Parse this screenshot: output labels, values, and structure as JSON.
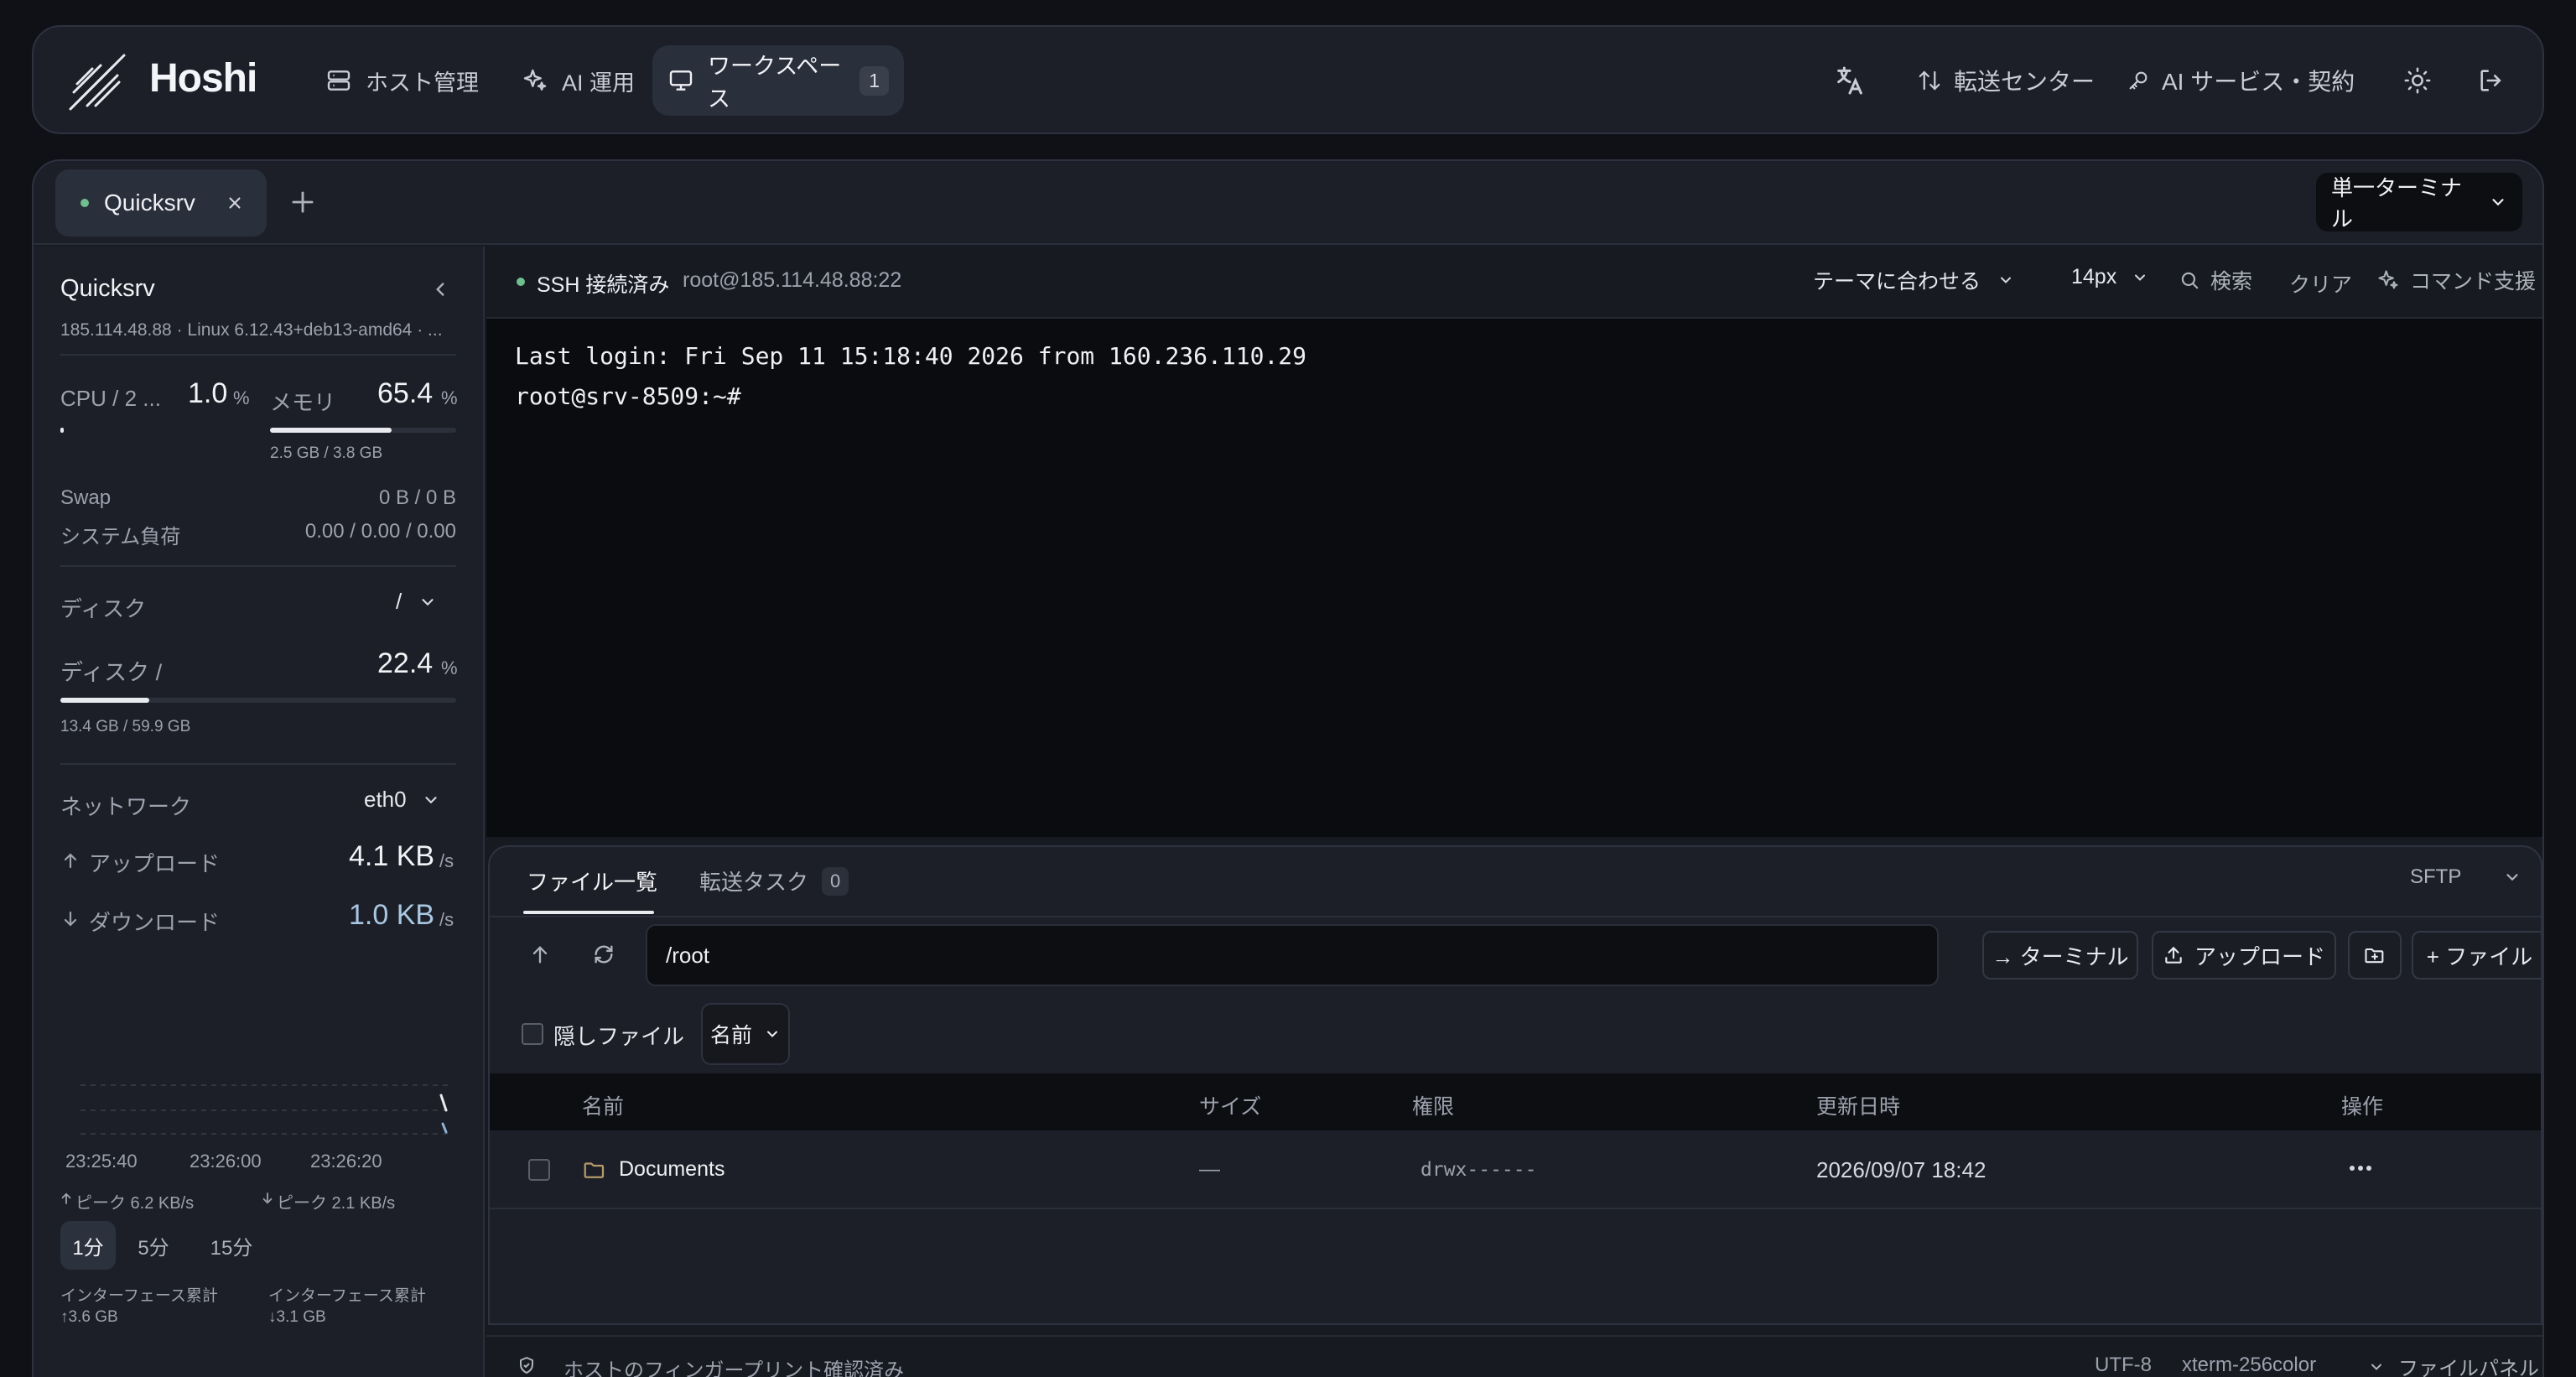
{
  "app": {
    "name": "Hoshi"
  },
  "nav": {
    "items": [
      {
        "label": "ホスト管理",
        "icon": "server-icon"
      },
      {
        "label": "AI 運用",
        "icon": "sparkles-icon"
      },
      {
        "label": "ワークスペース",
        "icon": "monitor-icon",
        "badge": "1",
        "active": true
      }
    ],
    "right": {
      "translate_icon": "translate-icon",
      "transfer_label": "転送センター",
      "ai_service_label": "AI サービス・契約",
      "theme_icon": "sun-icon",
      "logout_icon": "logout-icon"
    }
  },
  "workspace": {
    "tab_label": "Quicksrv",
    "mode_label": "単一ターミナル"
  },
  "sidebar": {
    "host_name": "Quicksrv",
    "host_info": "185.114.48.88 · Linux 6.12.43+deb13-amd64 · ...",
    "cpu_label": "CPU / 2 ...",
    "cpu_value": "1.0",
    "cpu_percent": 1.0,
    "mem_label": "メモリ",
    "mem_value": "65.4",
    "mem_percent": 65.4,
    "mem_detail": "2.5 GB / 3.8 GB",
    "pct": "%",
    "swap_label": "Swap",
    "swap_value": "0 B / 0 B",
    "load_label": "システム負荷",
    "load_value": "0.00 / 0.00 / 0.00",
    "disk_section": "ディスク",
    "disk_select": "/",
    "disk_label": "ディスク /",
    "disk_value": "22.4",
    "disk_percent": 22.4,
    "disk_detail": "13.4 GB / 59.9 GB",
    "net_section": "ネットワーク",
    "net_select": "eth0",
    "upload_label": "アップロード",
    "upload_value": "4.1 KB",
    "download_label": "ダウンロード",
    "download_value": "1.0 KB",
    "per_sec": "/s",
    "times": [
      "23:25:40",
      "23:26:00",
      "23:26:20"
    ],
    "peak_up": "ピーク 6.2 KB/s",
    "peak_down": "ピーク 2.1 KB/s",
    "ranges": [
      "1分",
      "5分",
      "15分"
    ],
    "iface_up_label": "インターフェース累計",
    "iface_up_value": "↑3.6 GB",
    "iface_down_label": "インターフェース累計",
    "iface_down_value": "↓3.1 GB"
  },
  "terminal": {
    "status": "SSH 接続済み",
    "address": "root@185.114.48.88:22",
    "theme_label": "テーマに合わせる",
    "font_size": "14px",
    "search_label": "検索",
    "clear_label": "クリア",
    "assist_label": "コマンド支援",
    "lines": [
      "Last login: Fri Sep 11 15:18:40 2026 from 160.236.110.29",
      "root@srv-8509:~#"
    ]
  },
  "files": {
    "tab_list": "ファイル一覧",
    "tab_transfer": "転送タスク",
    "transfer_count": "0",
    "protocol": "SFTP",
    "path": "/root",
    "btn_terminal": "→ ターミナル",
    "btn_upload": "アップロード",
    "btn_file": "+ ファイル",
    "hidden_label": "隠しファイル",
    "sort_label": "名前",
    "columns": [
      "名前",
      "サイズ",
      "権限",
      "更新日時",
      "操作"
    ],
    "rows": [
      {
        "name": "Documents",
        "size": "—",
        "perm": "drwx------",
        "date": "2026/09/07 18:42",
        "actions": "···"
      }
    ]
  },
  "statusbar": {
    "fingerprint": "ホストのフィンガープリント確認済み",
    "encoding": "UTF-8",
    "term_type": "xterm-256color",
    "panel_label": "ファイルパネル"
  }
}
